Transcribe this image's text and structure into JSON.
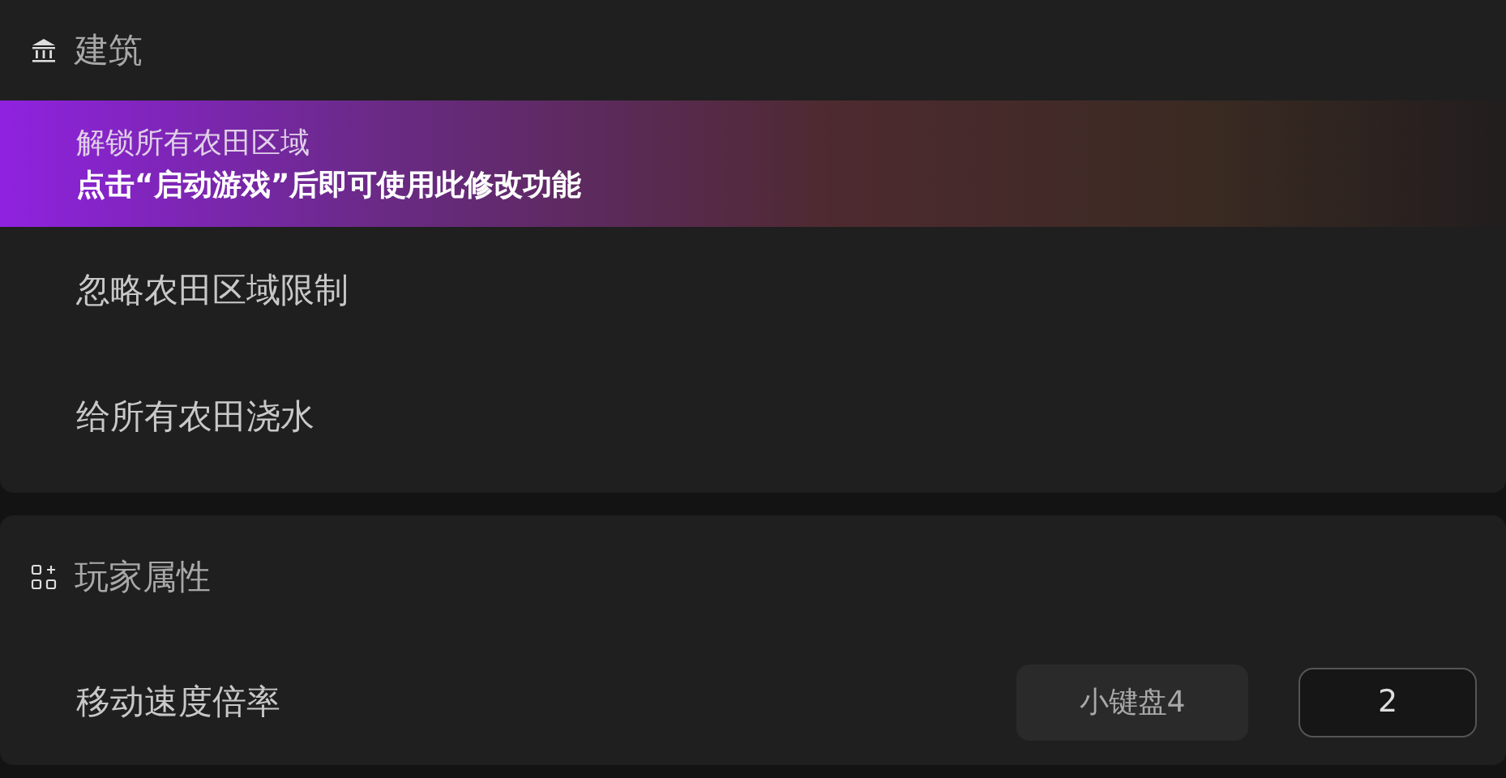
{
  "sections": [
    {
      "title": "建筑",
      "kind": "building",
      "items": [
        {
          "kind": "toggle",
          "label": "解锁所有农田区域",
          "highlighted": true,
          "hint": "点击“启动游戏”后即可使用此修改功能"
        },
        {
          "kind": "toggle",
          "label": "忽略农田区域限制",
          "highlighted": false
        },
        {
          "kind": "toggle",
          "label": "给所有农田浇水",
          "highlighted": false
        }
      ]
    },
    {
      "title": "玩家属性",
      "kind": "player",
      "items": [
        {
          "kind": "value",
          "label": "移动速度倍率",
          "highlighted": false,
          "hotkey": "小键盘4",
          "value": "2"
        }
      ]
    }
  ]
}
